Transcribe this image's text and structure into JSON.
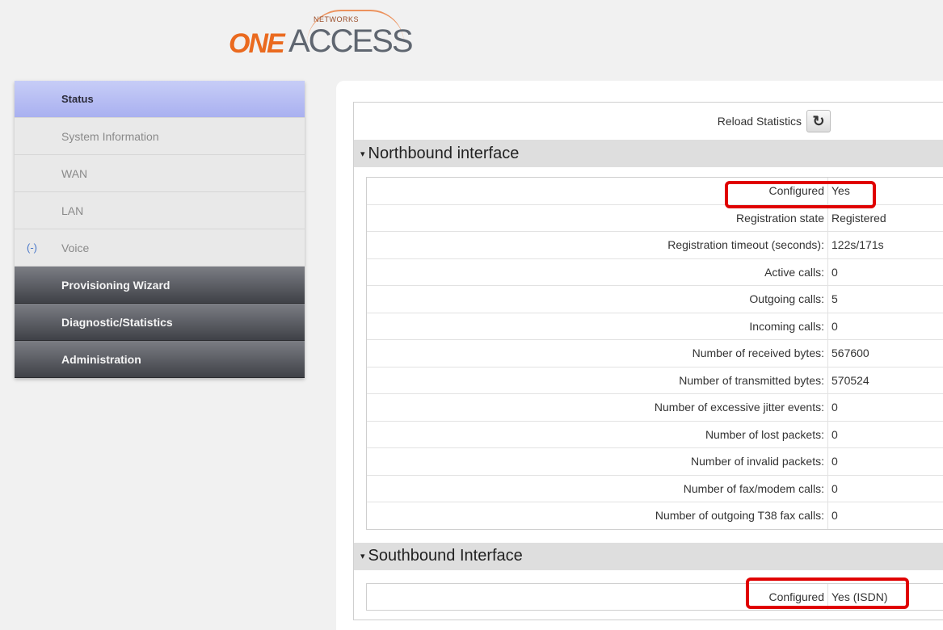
{
  "logo": {
    "networks": "NETWORKS",
    "one": "ONE",
    "access": "ACCESS"
  },
  "sidebar": {
    "items": [
      {
        "label": "Status",
        "state": "active"
      },
      {
        "label": "System Information",
        "state": "sub"
      },
      {
        "label": "WAN",
        "state": "sub"
      },
      {
        "label": "LAN",
        "state": "sub"
      },
      {
        "label": "Voice",
        "state": "sub",
        "toggle": "(-)"
      },
      {
        "label": "Provisioning Wizard",
        "state": "section"
      },
      {
        "label": "Diagnostic/Statistics",
        "state": "section"
      },
      {
        "label": "Administration",
        "state": "section"
      }
    ]
  },
  "toolbar": {
    "reload_label": "Reload Statistics",
    "reload_icon": "refresh-icon"
  },
  "northbound": {
    "title": "Northbound interface",
    "rows": [
      {
        "label": "Configured",
        "value": "Yes"
      },
      {
        "label": "Registration state",
        "value": "Registered"
      },
      {
        "label": "Registration timeout (seconds):",
        "value": "122s/171s"
      },
      {
        "label": "Active calls:",
        "value": "0"
      },
      {
        "label": "Outgoing calls:",
        "value": "5"
      },
      {
        "label": "Incoming calls:",
        "value": "0"
      },
      {
        "label": "Number of received bytes:",
        "value": "567600"
      },
      {
        "label": "Number of transmitted bytes:",
        "value": "570524"
      },
      {
        "label": "Number of excessive jitter events:",
        "value": "0"
      },
      {
        "label": "Number of lost packets:",
        "value": "0"
      },
      {
        "label": "Number of invalid packets:",
        "value": "0"
      },
      {
        "label": "Number of fax/modem calls:",
        "value": "0"
      },
      {
        "label": "Number of outgoing T38 fax calls:",
        "value": "0"
      }
    ]
  },
  "southbound": {
    "title": "Southbound Interface",
    "rows": [
      {
        "label": "Configured",
        "value": "Yes (ISDN)"
      }
    ]
  },
  "colors": {
    "highlight": "#e00000",
    "active_nav": "#b3b9f2",
    "dark_nav": "#4a4c52",
    "logo_orange": "#ea6a1f"
  }
}
